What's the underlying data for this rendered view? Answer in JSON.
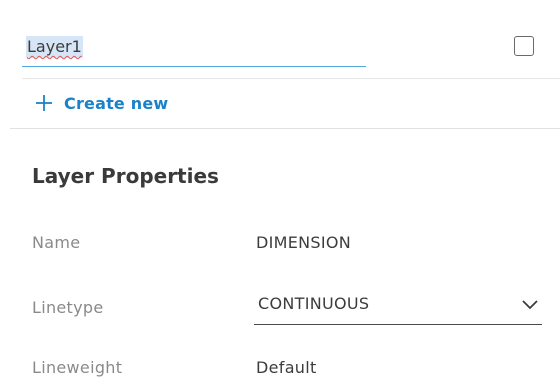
{
  "layer_name": {
    "value": "Layer1"
  },
  "create_new": {
    "label": "Create new"
  },
  "properties": {
    "title": "Layer Properties",
    "rows": [
      {
        "label": "Name",
        "value": "DIMENSION"
      },
      {
        "label": "Linetype",
        "value": "CONTINUOUS"
      },
      {
        "label": "Lineweight",
        "value": "Default"
      }
    ]
  },
  "colors": {
    "accent": "#1b82c8",
    "selection": "#d7e6f6",
    "input_underline": "#54a6dd"
  },
  "icons": {
    "create": "plus-icon",
    "linetype_dropdown": "chevron-down-icon"
  }
}
